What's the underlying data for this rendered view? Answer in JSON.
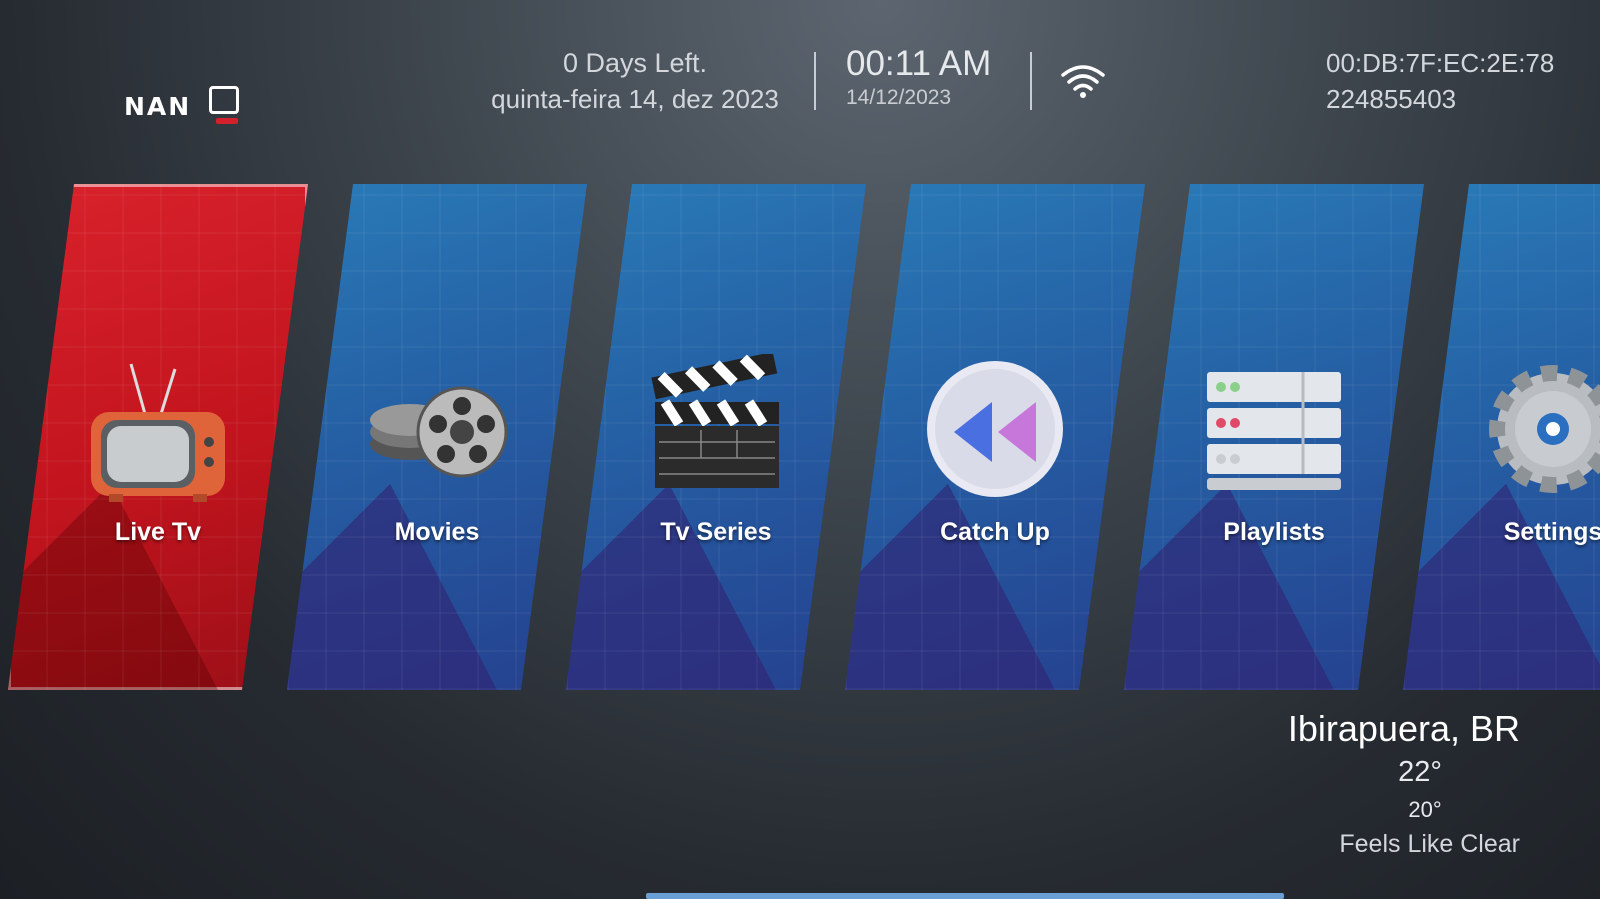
{
  "header": {
    "logo_text": "NAN",
    "days_left": "0 Days Left.",
    "long_date": "quinta-feira 14, dez 2023",
    "time": "00:11 AM",
    "short_date": "14/12/2023",
    "mac_address": "00:DB:7F:EC:2E:78",
    "device_id": "224855403"
  },
  "menu": {
    "items": [
      {
        "label": "Live Tv",
        "icon": "tv-icon",
        "active": true
      },
      {
        "label": "Movies",
        "icon": "film-reels-icon",
        "active": false
      },
      {
        "label": "Tv Series",
        "icon": "clapperboard-icon",
        "active": false
      },
      {
        "label": "Catch Up",
        "icon": "rewind-icon",
        "active": false
      },
      {
        "label": "Playlists",
        "icon": "server-stack-icon",
        "active": false
      },
      {
        "label": "Settings",
        "icon": "gear-icon",
        "active": false
      }
    ]
  },
  "weather": {
    "location": "Ibirapuera, BR",
    "temp_high": "22°",
    "temp_low": "20°",
    "description": "Feels Like Clear"
  },
  "colors": {
    "active_tile": "#c2141e",
    "tile": "#2562a6",
    "scrollbar": "#6a9fd6"
  }
}
